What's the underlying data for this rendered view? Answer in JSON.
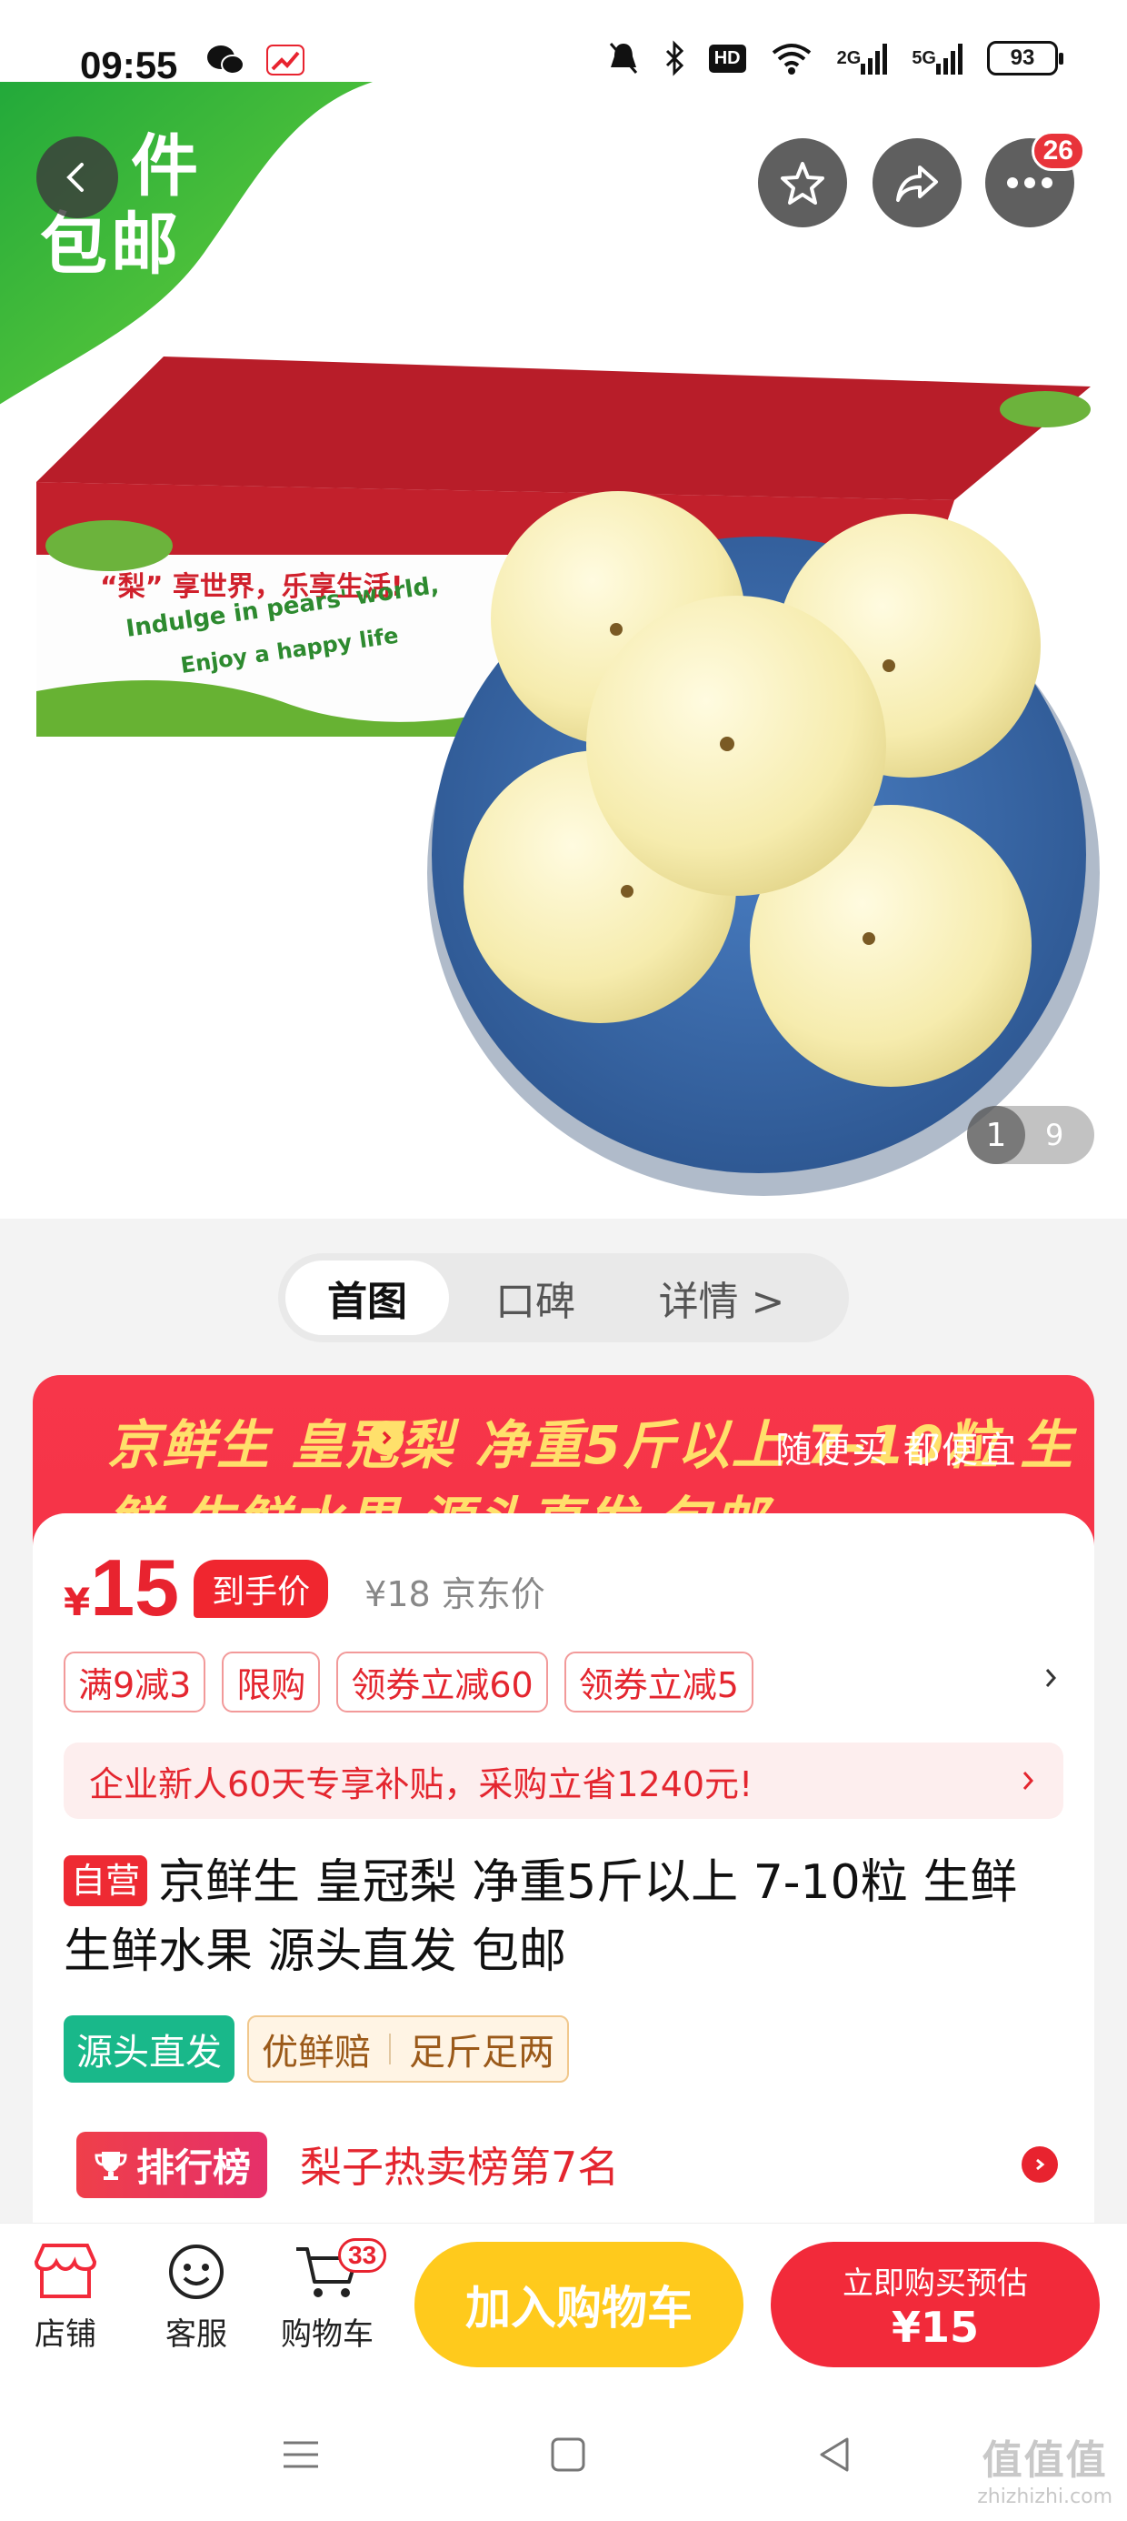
{
  "status_bar": {
    "time": "09:55",
    "hd_label": "HD",
    "signal_1": "2G",
    "signal_2": "5G",
    "battery": "93"
  },
  "hero": {
    "promo_badge_line1": "件",
    "promo_badge_line2": "包邮",
    "more_badge": "26",
    "image_index": "1",
    "image_total": "9",
    "box_slogan_cn": "“梨” 享世界，乐享生活!",
    "box_slogan_en1": "Indulge in pears' world,",
    "box_slogan_en2": "Enjoy a happy life"
  },
  "tabs": {
    "items": [
      "首图",
      "口碑",
      "详情 >"
    ]
  },
  "promo": {
    "title": "京鲜生 皇冠梨 净重5斤以上 7-10粒 生鲜 生鲜水果 源头直发 包邮",
    "slogan": "随便买 都便宜",
    "yen": "¥",
    "price": "15",
    "hand_price_label": "到手价",
    "jd_price": "¥18 京东价",
    "tags": [
      "满9减3",
      "限购",
      "领券立减60",
      "领券立减5"
    ],
    "bonus": "企业新人60天专享补贴，采购立省1240元!",
    "self_tag": "自营",
    "feature_green": "源头直发",
    "feature_orange_1": "优鲜赔",
    "feature_orange_2": "足斤足两",
    "rank_badge": "排行榜",
    "rank_text": "梨子热卖榜第7名"
  },
  "action_bar": {
    "store": "店铺",
    "service": "客服",
    "cart": "购物车",
    "cart_count": "33",
    "add_cart": "加入购物车",
    "buy_line1": "立即购买预估",
    "buy_line2": "¥15"
  },
  "watermark": {
    "mark": "值值值",
    "url": "zhizhizhi.com"
  },
  "colors": {
    "brand_red": "#f22a3a",
    "promo_yellow": "#ffe06b",
    "add_cart_yellow": "#ffca1c",
    "green_corner": "#2dbb3a"
  }
}
